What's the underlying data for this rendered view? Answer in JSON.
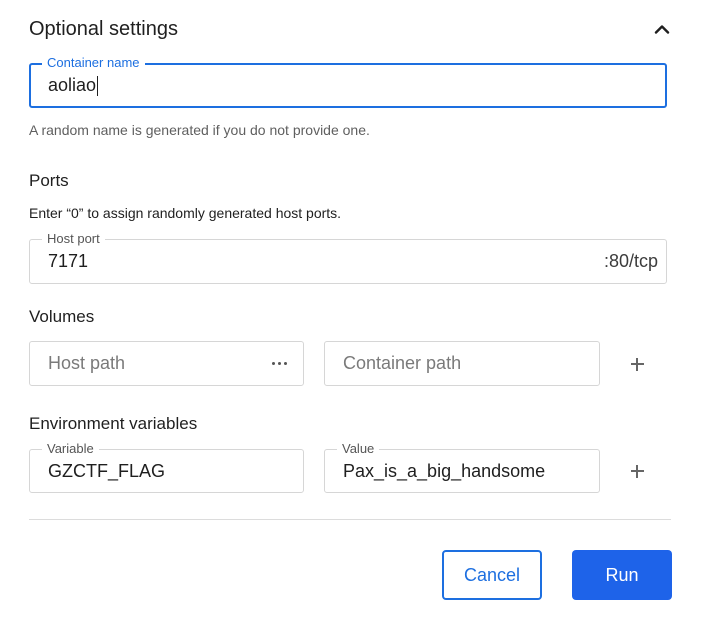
{
  "optional_settings": {
    "title": "Optional settings"
  },
  "container_name": {
    "label": "Container name",
    "value": "aoliao",
    "helper": "A random name is generated if you do not provide one."
  },
  "ports": {
    "heading": "Ports",
    "description": "Enter “0” to assign randomly generated host ports.",
    "host_port_label": "Host port",
    "host_port_value": "7171",
    "container_port_suffix": ":80/tcp"
  },
  "volumes": {
    "heading": "Volumes",
    "host_path_placeholder": "Host path",
    "container_path_placeholder": "Container path"
  },
  "env": {
    "heading": "Environment variables",
    "variable_label": "Variable",
    "variable_value": "GZCTF_FLAG",
    "value_label": "Value",
    "value_value": "Pax_is_a_big_handsome"
  },
  "actions": {
    "cancel_label": "Cancel",
    "run_label": "Run"
  },
  "icons": {
    "collapse": "chevron-up-icon",
    "browse": "more-horizontal-icon",
    "add": "plus-icon"
  },
  "colors": {
    "accent": "#1d6fe0",
    "primary_button": "#1e63e9"
  }
}
